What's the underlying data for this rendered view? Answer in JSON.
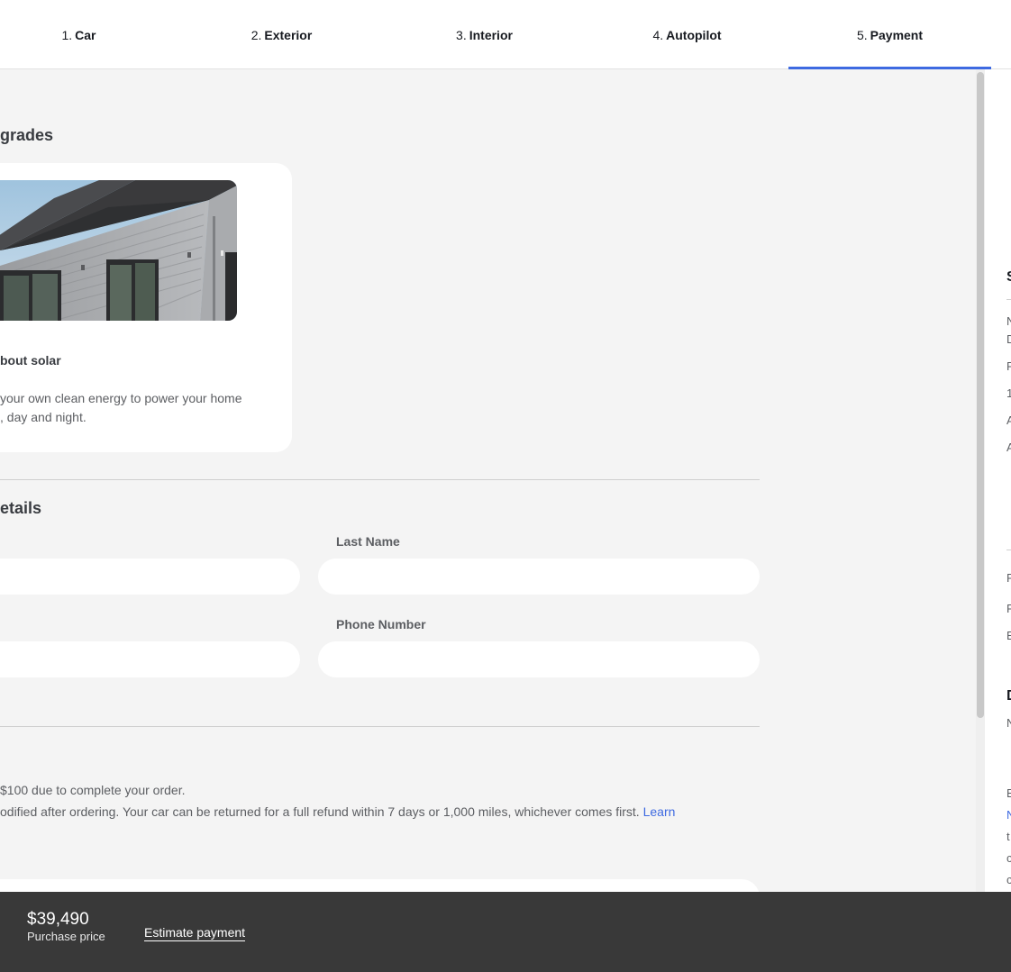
{
  "nav": {
    "steps": [
      {
        "num": "1.",
        "label": "Car"
      },
      {
        "num": "2.",
        "label": "Exterior"
      },
      {
        "num": "3.",
        "label": "Interior"
      },
      {
        "num": "4.",
        "label": "Autopilot"
      },
      {
        "num": "5.",
        "label": "Payment"
      }
    ],
    "active_step": 5,
    "accent_color": "#3e6ae1"
  },
  "upgrades": {
    "title": "grades",
    "card": {
      "heading": "bout solar",
      "body_line1": "your own clean energy to power your home",
      "body_line2": ", day and night."
    }
  },
  "details": {
    "title": "etails",
    "last_name_label": "Last Name",
    "last_name_value": "",
    "phone_label": "Phone Number",
    "phone_value": ""
  },
  "order_info": {
    "line1": "$100 due to complete your order.",
    "line2": "odified after ordering. Your car can be returned for a full refund within 7 days or 1,000 miles, whichever comes first.",
    "learn_link": "Learn"
  },
  "sidebar_fragments": {
    "f1": "S",
    "f2": "N",
    "f3": "D",
    "f4": "P",
    "f5": "1",
    "f6": "A",
    "f7": "A",
    "f8": "P",
    "f9": "P",
    "f10": "E",
    "f11": "D",
    "f12": "N",
    "f13": "E",
    "f14": "N",
    "f15": "t",
    "f16": "c",
    "f17": "c"
  },
  "bottom_bar": {
    "price": "$39,490",
    "price_label": "Purchase price",
    "estimate_link": "Estimate payment"
  }
}
